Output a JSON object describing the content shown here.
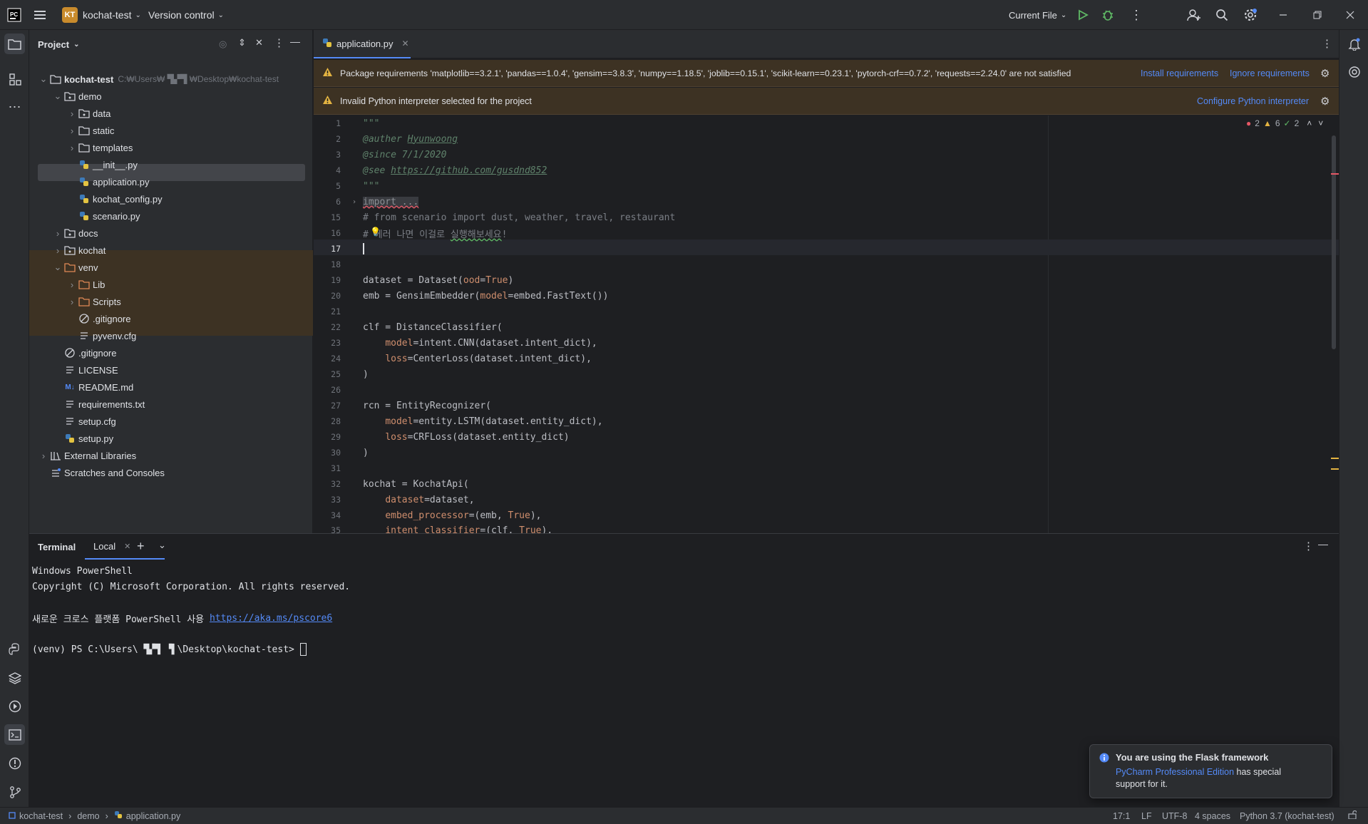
{
  "titlebar": {
    "project_badge": "KT",
    "project_name": "kochat-test",
    "vcs": "Version control",
    "run_config": "Current File"
  },
  "project_panel": {
    "title": "Project",
    "rows": [
      {
        "label": "kochat-test",
        "suffix": "C:₩Users₩  ▜▞▜  ₩Desktop₩kochat-test",
        "bold": true
      },
      {
        "label": "demo"
      },
      {
        "label": "data"
      },
      {
        "label": "static"
      },
      {
        "label": "templates"
      },
      {
        "label": "__init__.py"
      },
      {
        "label": "application.py"
      },
      {
        "label": "kochat_config.py"
      },
      {
        "label": "scenario.py"
      },
      {
        "label": "docs"
      },
      {
        "label": "kochat"
      },
      {
        "label": "venv"
      },
      {
        "label": "Lib"
      },
      {
        "label": "Scripts"
      },
      {
        "label": ".gitignore"
      },
      {
        "label": "pyvenv.cfg"
      },
      {
        "label": ".gitignore"
      },
      {
        "label": "LICENSE"
      },
      {
        "label": "README.md"
      },
      {
        "label": "requirements.txt"
      },
      {
        "label": "setup.cfg"
      },
      {
        "label": "setup.py"
      },
      {
        "label": "External Libraries"
      },
      {
        "label": "Scratches and Consoles"
      }
    ]
  },
  "editor": {
    "tab": "application.py",
    "banner1": {
      "text": "Package requirements 'matplotlib==3.2.1', 'pandas==1.0.4', 'gensim==3.8.3', 'numpy==1.18.5', 'joblib==0.15.1', 'scikit-learn==0.23.1', 'pytorch-crf==0.7.2', 'requests==2.24.0' are not satisfied",
      "action1": "Install requirements",
      "action2": "Ignore requirements"
    },
    "banner2": {
      "text": "Invalid Python interpreter selected for the project",
      "action": "Configure Python interpreter"
    },
    "inspections": {
      "errors": "2",
      "warnings": "6",
      "ok": "2"
    },
    "line_numbers": [
      "1",
      "2",
      "3",
      "4",
      "5",
      "6",
      "15",
      "16",
      "17",
      "18",
      "19",
      "20",
      "21",
      "22",
      "23",
      "24",
      "25",
      "26",
      "27",
      "28",
      "29",
      "30",
      "31",
      "32",
      "33",
      "34",
      "35"
    ],
    "code": {
      "l1": "\"\"\"",
      "l2a": "@auther ",
      "l2b": "Hyunwoong",
      "l3": "@since 7/1/2020",
      "l4a": "@see ",
      "l4b": "https://github.com/gusdnd852",
      "l5": "\"\"\"",
      "l6": "import ...",
      "l15": "# from scenario import dust, weather, travel, restaurant",
      "l16a": "# ",
      "l16b": "에러 나면 이걸로 ",
      "l16c": "실행해보세요",
      "l16d": "!",
      "l19a": "dataset = Dataset(",
      "l19b": "ood",
      "l19c": "=",
      "l19d": "True",
      "l19e": ")",
      "l20a": "emb = GensimEmbedder(",
      "l20b": "model",
      "l20c": "=embed.FastText())",
      "l22": "clf = DistanceClassifier(",
      "l23a": "model",
      "l23b": "=intent.CNN(dataset.intent_dict),",
      "l24a": "loss",
      "l24b": "=CenterLoss(dataset.intent_dict),",
      "l25": ")",
      "l27": "rcn = EntityRecognizer(",
      "l28a": "model",
      "l28b": "=entity.LSTM(dataset.entity_dict),",
      "l29a": "loss",
      "l29b": "=CRFLoss(dataset.entity_dict)",
      "l30": ")",
      "l32": "kochat = KochatApi(",
      "l33a": "dataset",
      "l33b": "=dataset,",
      "l34a": "embed_processor",
      "l34b": "=(emb, ",
      "l34c": "True",
      "l34d": "),",
      "l35a": "intent_classifier",
      "l35b": "=(clf, ",
      "l35c": "True",
      "l35d": "),"
    }
  },
  "terminal": {
    "title": "Terminal",
    "tab": "Local",
    "line1": "Windows PowerShell",
    "line2": "Copyright (C) Microsoft Corporation. All rights reserved.",
    "line3a": "새로운 크로스 플랫폼 PowerShell 사용 ",
    "line3b": "https://aka.ms/pscore6",
    "line4": "(venv) PS C:\\Users\\ ▜▞▜ ▝▌\\Desktop\\kochat-test> "
  },
  "notification": {
    "title": "You are using the Flask framework",
    "link": "PyCharm Professional Edition",
    "text1": " has special",
    "text2": "support for it."
  },
  "statusbar": {
    "crumb1": "kochat-test",
    "crumb2": "demo",
    "crumb3": "application.py",
    "pos": "17:1",
    "eol": "LF",
    "enc": "UTF-8",
    "indent": "4 spaces",
    "interp": "Python 3.7 (kochat-test)"
  },
  "colors": {
    "accent": "#548af7",
    "warning_bg": "#3d3223",
    "error": "#e55765",
    "warning": "#e3b341",
    "run": "#5fb865"
  }
}
